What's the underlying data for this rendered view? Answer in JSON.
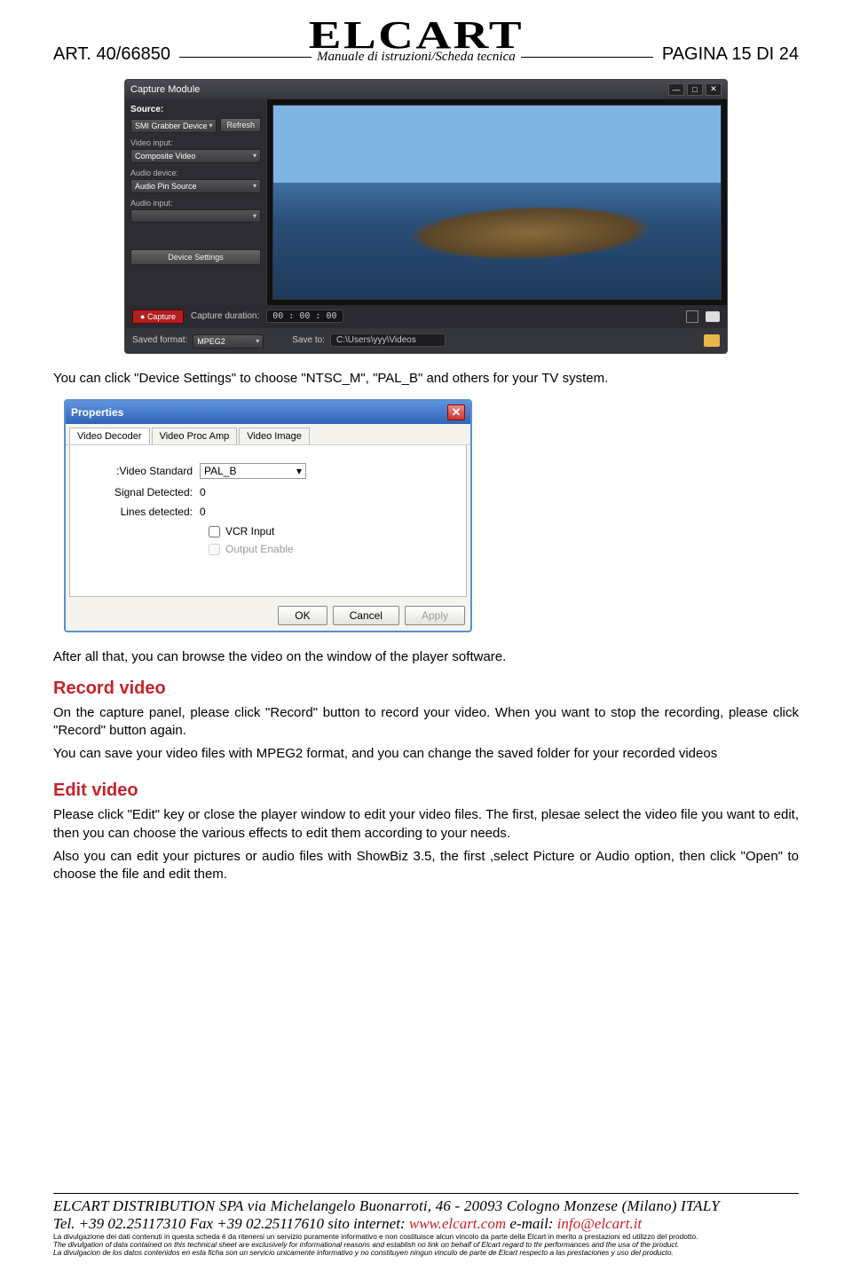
{
  "header": {
    "art_code": "ART. 40/66850",
    "logo": "ELCART",
    "subtitle": "Manuale di istruzioni/Scheda tecnica",
    "page": "PAGINA 15 DI 24"
  },
  "capture": {
    "title": "Capture Module",
    "source_label": "Source:",
    "source_value": "SMI Grabber Device",
    "refresh": "Refresh",
    "video_input_label": "Video input:",
    "video_input_value": "Composite Video",
    "audio_device_label": "Audio device:",
    "audio_device_value": "Audio Pin Source",
    "audio_input_label": "Audio input:",
    "audio_input_value": "",
    "device_settings": "Device Settings",
    "capture_btn": "Capture",
    "duration_label": "Capture duration:",
    "duration_value": "00 : 00 : 00",
    "saved_fmt_label": "Saved format:",
    "saved_fmt_value": "MPEG2",
    "save_to_label": "Save to:",
    "save_to_value": "C:\\Users\\yyy\\Videos"
  },
  "para1": "You can click \"Device Settings\" to choose \"NTSC_M\", \"PAL_B\" and others for your TV system.",
  "props": {
    "title": "Properties",
    "tabs": [
      "Video Decoder",
      "Video Proc Amp",
      "Video Image"
    ],
    "std_label": ":Video Standard",
    "std_value": "PAL_B",
    "sig_label": "Signal Detected:",
    "sig_value": "0",
    "lines_label": "Lines detected:",
    "lines_value": "0",
    "vcr": "VCR Input",
    "outen": "Output Enable",
    "ok": "OK",
    "cancel": "Cancel",
    "apply": "Apply"
  },
  "para2": "After all that, you can browse the video on the window of the player software.",
  "record": {
    "heading": "Record video",
    "p1": "On the capture panel, please click \"Record\" button to record your video. When you want to stop the recording, please click \"Record\" button again.",
    "p2": "You can save your video files with MPEG2 format, and you can change the saved folder for your recorded videos"
  },
  "edit": {
    "heading": "Edit video",
    "p1": "Please click \"Edit\" key or close the player window to edit your video files. The first, plesae select the video file you want to edit, then you can choose the various effects to edit them according to your needs.",
    "p2": "Also you can edit your pictures or audio files with ShowBiz 3.5, the first ,select Picture or Audio option, then click \"Open\" to choose the file and edit them."
  },
  "footer": {
    "line1": "ELCART DISTRIBUTION SPA  via Michelangelo Buonarroti, 46 - 20093 Cologno Monzese (Milano) ITALY",
    "line2a": "Tel. +39 02.25117310 Fax +39 02.25117610 sito internet: ",
    "site": "www.elcart.com",
    "line2b": "     e-mail: ",
    "email": "info@elcart.it",
    "d1": "La divulgazione dei dati contenuti in questa scheda è da ritenersi un servizio puramente informativo e non costituisce alcun vincolo da parte della Elcart in merito a prestazioni ed utilizzo del prodotto.",
    "d2": "The divulgation of data contained on this technical sheet are exclusively for informational reasons and establish no link on behalf of Elcart regard to thr performances and the usa of the product.",
    "d3": "La divulgacion de los datos contenidos en esta ficha son un servicio unicamente informativo y no constituyen ningun vinculo de parte de Elcart respecto a las prestaciones y uso del producto."
  }
}
